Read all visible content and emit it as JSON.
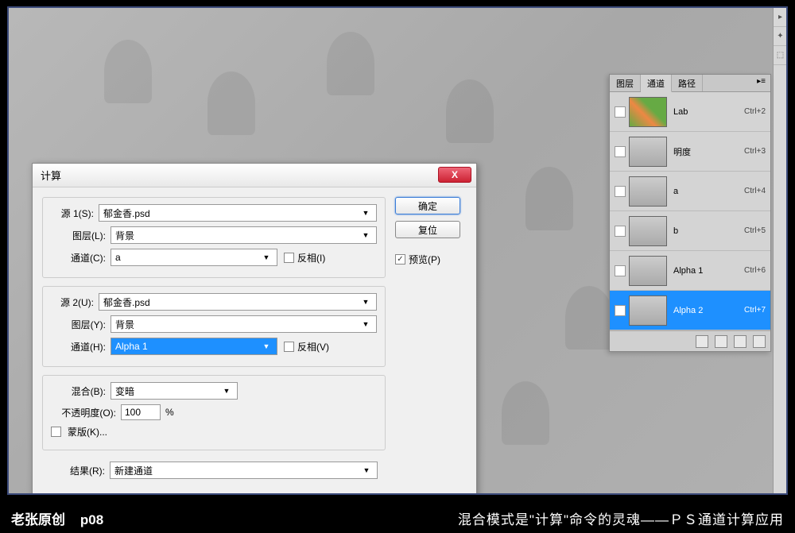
{
  "footer": {
    "left_author": "老张原创",
    "left_page": "p08",
    "right": "混合模式是\"计算\"命令的灵魂——ＰＳ通道计算应用"
  },
  "dialog": {
    "title": "计算",
    "close": "X",
    "source1": {
      "label": "源 1(S):",
      "file": "郁金香.psd",
      "layer_label": "图层(L):",
      "layer": "背景",
      "channel_label": "通道(C):",
      "channel": "a",
      "invert_label": "反相(I)"
    },
    "source2": {
      "label": "源 2(U):",
      "file": "郁金香.psd",
      "layer_label": "图层(Y):",
      "layer": "背景",
      "channel_label": "通道(H):",
      "channel": "Alpha 1",
      "invert_label": "反相(V)"
    },
    "blend": {
      "label": "混合(B):",
      "mode": "变暗",
      "opacity_label": "不透明度(O):",
      "opacity": "100",
      "percent": "%",
      "mask_label": "蒙版(K)..."
    },
    "result": {
      "label": "结果(R):",
      "value": "新建通道"
    },
    "buttons": {
      "ok": "确定",
      "reset": "复位",
      "preview": "预览(P)"
    }
  },
  "panel": {
    "tabs": {
      "layers": "图层",
      "channels": "通道",
      "paths": "路径"
    },
    "channels": [
      {
        "name": "Lab",
        "shortcut": "Ctrl+2",
        "thumb": "lab",
        "visible": false,
        "selected": false
      },
      {
        "name": "明度",
        "shortcut": "Ctrl+3",
        "thumb": "gray",
        "visible": false,
        "selected": false
      },
      {
        "name": "a",
        "shortcut": "Ctrl+4",
        "thumb": "gray",
        "visible": false,
        "selected": false
      },
      {
        "name": "b",
        "shortcut": "Ctrl+5",
        "thumb": "gray",
        "visible": false,
        "selected": false
      },
      {
        "name": "Alpha 1",
        "shortcut": "Ctrl+6",
        "thumb": "gray",
        "visible": false,
        "selected": false
      },
      {
        "name": "Alpha 2",
        "shortcut": "Ctrl+7",
        "thumb": "gray",
        "visible": true,
        "selected": true
      }
    ]
  }
}
